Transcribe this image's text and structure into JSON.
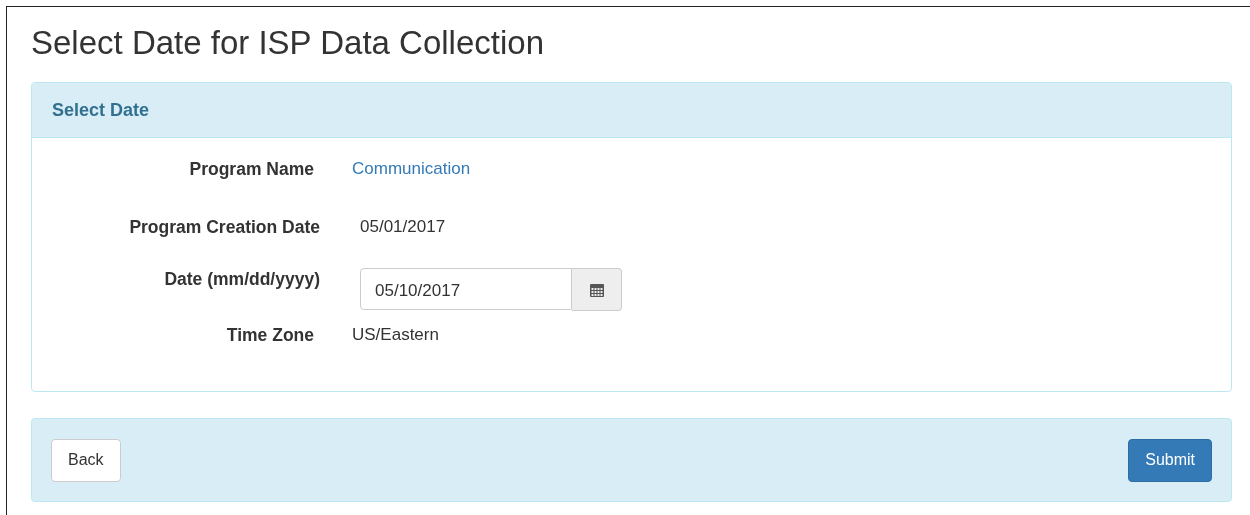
{
  "page": {
    "title": "Select Date for ISP Data Collection"
  },
  "panel": {
    "heading": "Select Date",
    "fields": [
      {
        "kind": "link",
        "label": "Program Name",
        "value": "Communication"
      },
      {
        "kind": "text",
        "label": "Program Creation Date",
        "value": "05/01/2017"
      },
      {
        "kind": "date",
        "label": "Date (mm/dd/yyyy)",
        "value": "05/10/2017"
      },
      {
        "kind": "text",
        "label": "Time Zone",
        "value": "US/Eastern"
      }
    ]
  },
  "footer": {
    "buttons": [
      {
        "label": "Back",
        "kind": "default"
      },
      {
        "label": "Submit",
        "kind": "primary"
      }
    ]
  }
}
